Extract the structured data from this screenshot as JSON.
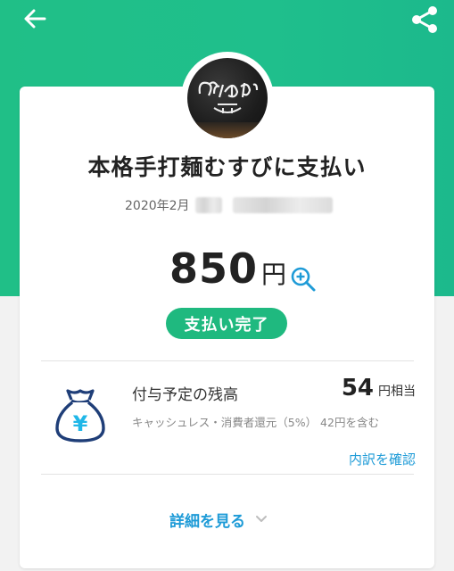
{
  "header": {
    "back_icon": "arrow-left-icon",
    "share_icon": "share-icon",
    "accent_color": "#20bf87"
  },
  "merchant": {
    "avatar_text": "めっむすび",
    "name": "本格手打麺むすびに支払い",
    "date": "2020年2月"
  },
  "payment": {
    "amount": "850",
    "currency_unit": "円",
    "zoom_icon": "zoom-in-icon",
    "status": "支払い完了",
    "status_color": "#1fb97f"
  },
  "points": {
    "icon": "money-bag-yen-icon",
    "symbol": "¥",
    "title": "付与予定の残高",
    "value": "54",
    "unit": "円相当",
    "note": "キャッシュレス・消費者還元（5%） 42円を含む",
    "breakdown_label": "内訳を確認",
    "link_color": "#1e9bd7"
  },
  "details": {
    "label": "詳細を見る",
    "chevron_icon": "chevron-down-icon"
  }
}
